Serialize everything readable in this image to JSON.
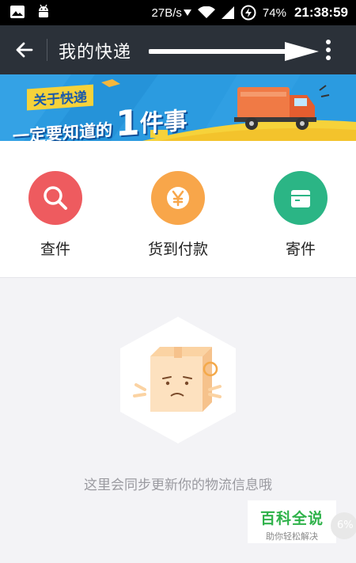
{
  "status_bar": {
    "network_speed": "27B/s",
    "battery_percent": "74%",
    "time": "21:38:59",
    "icons": [
      "image-icon",
      "android-icon",
      "download-icon",
      "wifi-icon",
      "signal-icon",
      "battery-icon"
    ]
  },
  "app_bar": {
    "title": "我的快递",
    "back_icon": "arrow-left-icon",
    "menu_icon": "more-vertical-icon"
  },
  "banner": {
    "line1": "关于快递",
    "line2": "一定要知道的",
    "big_char": "1",
    "line3": "件事",
    "colors": {
      "background": "#1f8fd6",
      "truck": "#f07a45",
      "road": "#f6d23a"
    }
  },
  "quick_actions": [
    {
      "label": "查件",
      "icon": "search-icon",
      "color": "#ee5b5f"
    },
    {
      "label": "货到付款",
      "icon": "yuan-icon",
      "color": "#f8a64a"
    },
    {
      "label": "寄件",
      "icon": "package-icon",
      "color": "#2bb585"
    }
  ],
  "empty_state": {
    "message": "这里会同步更新你的物流信息哦",
    "icon": "sad-box-icon"
  },
  "watermark": {
    "title": "百科全说",
    "subtitle": "助你轻松解决"
  },
  "badge": {
    "text": "6%"
  }
}
